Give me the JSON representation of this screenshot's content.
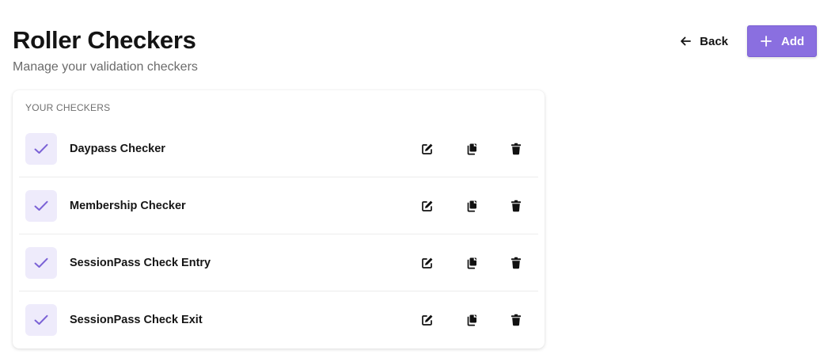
{
  "header": {
    "title": "Roller Checkers",
    "subtitle": "Manage your validation checkers",
    "back_label": "Back",
    "add_label": "Add"
  },
  "section": {
    "label": "YOUR CHECKERS"
  },
  "checkers": [
    {
      "label": "Daypass Checker"
    },
    {
      "label": "Membership Checker"
    },
    {
      "label": "SessionPass Check Entry"
    },
    {
      "label": "SessionPass Check Exit"
    }
  ],
  "icons": {
    "check": "check-icon",
    "edit": "edit-icon",
    "copy": "copy-icon",
    "delete": "trash-icon",
    "back": "arrow-left-icon",
    "add": "plus-icon"
  },
  "colors": {
    "accent": "#8a6fe0",
    "check_bg": "#eeebfb",
    "check_mark": "#7b62d6"
  }
}
